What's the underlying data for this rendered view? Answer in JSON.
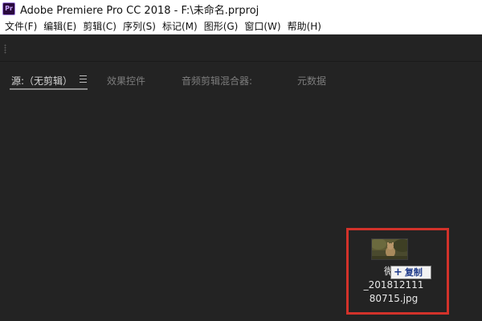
{
  "window": {
    "app_icon_text": "Pr",
    "title": "Adobe Premiere Pro CC 2018 - F:\\未命名.prproj"
  },
  "menu": [
    {
      "id": "file",
      "label": "文件(F)"
    },
    {
      "id": "edit",
      "label": "编辑(E)"
    },
    {
      "id": "clip",
      "label": "剪辑(C)"
    },
    {
      "id": "sequence",
      "label": "序列(S)"
    },
    {
      "id": "markers",
      "label": "标记(M)"
    },
    {
      "id": "graphics",
      "label": "图形(G)"
    },
    {
      "id": "window",
      "label": "窗口(W)"
    },
    {
      "id": "help",
      "label": "帮助(H)"
    }
  ],
  "panel": {
    "tabs": [
      {
        "id": "source",
        "label": "源:（无剪辑）",
        "active": true
      },
      {
        "id": "effect-controls",
        "label": "效果控件",
        "active": false
      },
      {
        "id": "audio-clip-mixer",
        "label": "音频剪辑混合器:",
        "active": false
      },
      {
        "id": "metadata",
        "label": "元数据",
        "active": false
      }
    ]
  },
  "drag_item": {
    "filename": "微信\n_201812111\n80715.jpg",
    "icon": "image-thumbnail-icon"
  },
  "drag_tooltip": {
    "icon": "plus-icon",
    "label": "复制"
  },
  "colors": {
    "panel_bg": "#232323",
    "highlight_border": "#d2322a",
    "tooltip_text": "#1e3a8a",
    "app_icon_bg": "#2a0a3e"
  }
}
